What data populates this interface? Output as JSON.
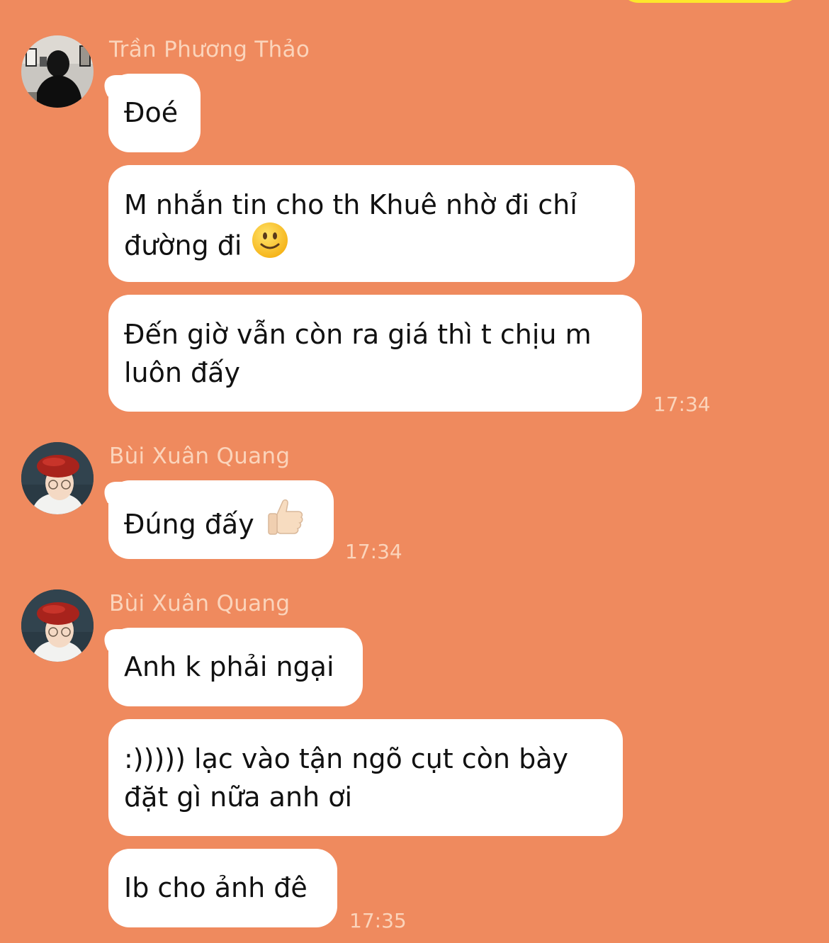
{
  "colors": {
    "background": "#ef8a5e",
    "bubble": "#ffffff",
    "meta_text": "#fbd4bb",
    "own_bubble": "#fde72b"
  },
  "groups": [
    {
      "sender": "Trần Phương Thảo",
      "avatar": "avatar-photo-woman-gallery",
      "messages": [
        {
          "text": "Đoé"
        },
        {
          "lines": [
            "M nhắn tin cho th Khuê nhờ đi chỉ",
            "đường đi"
          ],
          "emoji": "slightly-smiling-face"
        },
        {
          "lines": [
            "Đến giờ vẫn còn ra giá thì t chịu m",
            "luôn đấy"
          ]
        }
      ],
      "time": "17:34"
    },
    {
      "sender": "Bùi Xuân Quang",
      "avatar": "avatar-photo-red-beret",
      "messages": [
        {
          "text": "Đúng đấy",
          "emoji": "thumbs-up"
        }
      ],
      "time": "17:34"
    },
    {
      "sender": "Bùi Xuân Quang",
      "avatar": "avatar-photo-red-beret",
      "messages": [
        {
          "text": "Anh k phải ngại"
        },
        {
          "lines": [
            ":))))) lạc vào tận ngõ cụt còn bày",
            "đặt gì nữa anh ơi"
          ]
        },
        {
          "text": "Ib cho ảnh đê"
        }
      ],
      "time": "17:35"
    }
  ]
}
